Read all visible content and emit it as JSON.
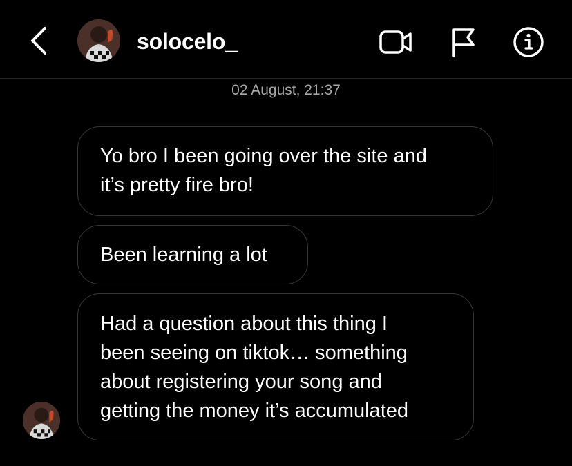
{
  "header": {
    "username": "solocelo_",
    "icons": {
      "back": "chevron-left-icon",
      "video": "video-call-icon",
      "flag": "flag-icon",
      "info": "info-icon"
    }
  },
  "thread": {
    "timestamp": "02 August, 21:37",
    "messages": [
      {
        "lines": [
          "Yo bro I been going over the site and",
          "it’s pretty fire bro!"
        ]
      },
      {
        "lines": [
          "Been learning a lot"
        ]
      },
      {
        "lines": [
          "Had a question about this thing I",
          "been seeing on tiktok… something",
          "about registering your song and",
          "getting the money it’s accumulated"
        ]
      }
    ]
  },
  "colors": {
    "background": "#000000",
    "bubble_border": "#363636",
    "timestamp_text": "#a8a8a8",
    "text": "#ffffff"
  }
}
